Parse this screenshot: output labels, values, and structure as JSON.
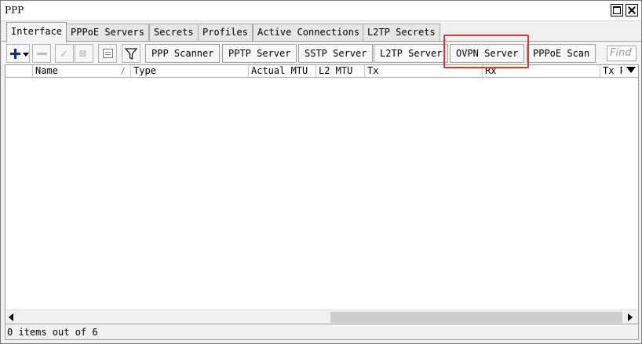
{
  "window": {
    "title": "PPP"
  },
  "tabs": [
    {
      "label": "Interface",
      "active": true
    },
    {
      "label": "PPPoE Servers"
    },
    {
      "label": "Secrets"
    },
    {
      "label": "Profiles"
    },
    {
      "label": "Active Connections"
    },
    {
      "label": "L2TP Secrets"
    }
  ],
  "toolbar": {
    "icons": [
      "add-icon",
      "remove-icon",
      "enable-check-icon",
      "disable-x-icon",
      "comment-icon",
      "filter-icon"
    ],
    "buttons": [
      "PPP Scanner",
      "PPTP Server",
      "SSTP Server",
      "L2TP Server",
      "OVPN Server",
      "PPPoE Scan"
    ],
    "find_placeholder": "Find"
  },
  "table": {
    "columns": [
      "Name",
      "Type",
      "Actual MTU",
      "L2 MTU",
      "Tx",
      "Rx",
      "Tx P"
    ],
    "sort_glyph": "/"
  },
  "status": {
    "text": "0 items out of 6"
  },
  "colors": {
    "highlight": "#e8332d",
    "add_icon": "#0a2f86"
  }
}
